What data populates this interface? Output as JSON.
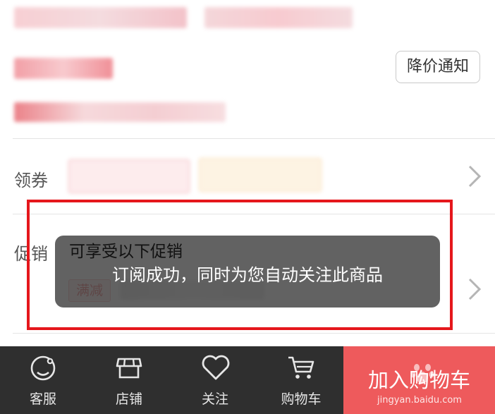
{
  "header": {
    "price_notify_label": "降价通知"
  },
  "coupon_row": {
    "label": "领券"
  },
  "promo_row": {
    "label": "促销",
    "header_text": "可享受以下促销",
    "tag_label": "满减"
  },
  "toast": {
    "message": "订阅成功，同时为您自动关注此商品"
  },
  "bottom_bar": {
    "tabs": [
      {
        "label": "客服",
        "icon": "customer-service-icon"
      },
      {
        "label": "店铺",
        "icon": "store-icon"
      },
      {
        "label": "关注",
        "icon": "heart-icon"
      },
      {
        "label": "购物车",
        "icon": "cart-icon"
      }
    ],
    "add_to_cart_label": "加入购物车"
  },
  "watermark": {
    "text": "jingyan.baidu.com"
  },
  "colors": {
    "accent_red": "#e5171c",
    "cart_button": "#ee5a5c",
    "tab_bar": "#2f2f2f",
    "toast_bg": "#484848"
  }
}
